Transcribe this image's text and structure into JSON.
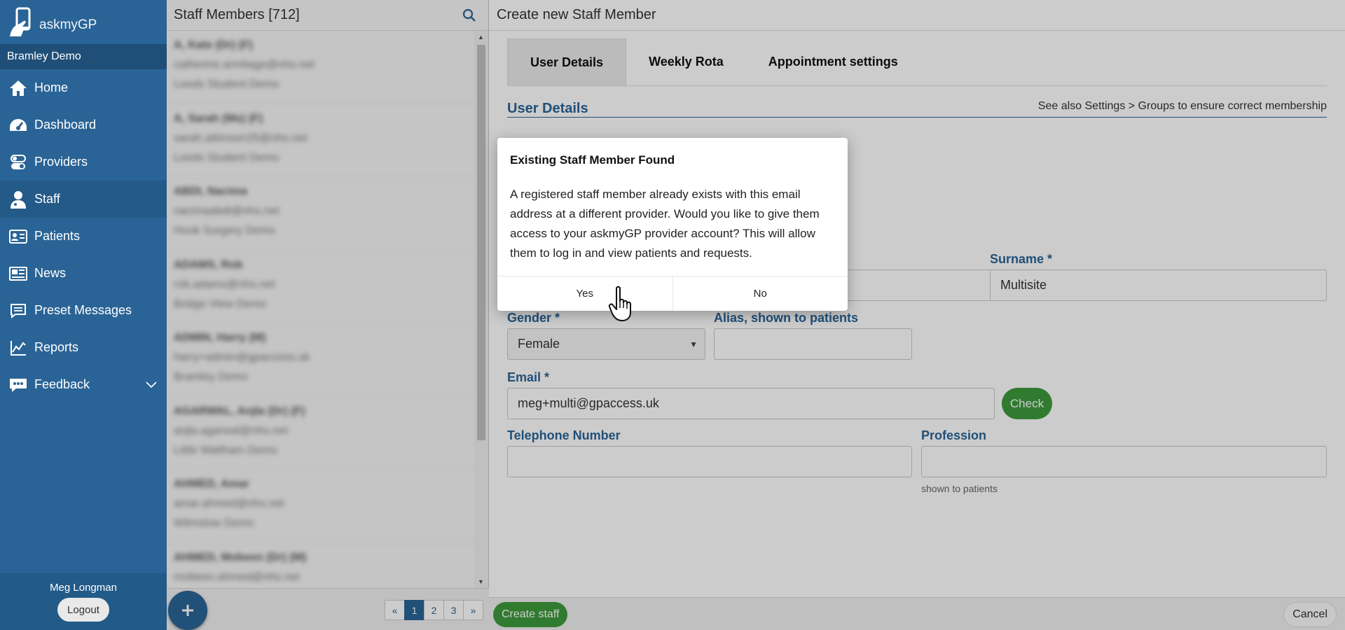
{
  "app": {
    "logo_text": "askmyGP",
    "practice": "Bramley Demo"
  },
  "nav": [
    {
      "label": "Home",
      "icon": "home-icon",
      "active": false
    },
    {
      "label": "Dashboard",
      "icon": "dashboard-icon",
      "active": false
    },
    {
      "label": "Providers",
      "icon": "toggle-icon",
      "active": false
    },
    {
      "label": "Staff",
      "icon": "staff-icon",
      "active": true
    },
    {
      "label": "Patients",
      "icon": "id-card-icon",
      "active": false
    },
    {
      "label": "News",
      "icon": "newspaper-icon",
      "active": false
    },
    {
      "label": "Preset Messages",
      "icon": "chat-icon",
      "active": false
    },
    {
      "label": "Reports",
      "icon": "chart-icon",
      "active": false
    },
    {
      "label": "Feedback",
      "icon": "feedback-icon",
      "active": false
    }
  ],
  "user": {
    "name": "Meg Longman",
    "logout_label": "Logout"
  },
  "list": {
    "title": "Staff Members [712]",
    "items": [
      {
        "name": "A, Kate (Dr) (F)",
        "email": "catherine.armitage@nhs.net",
        "org": "Leeds Student Demo"
      },
      {
        "name": "A, Sarah (Ms) (F)",
        "email": "sarah.atkinson25@nhs.net",
        "org": "Leeds Student Demo"
      },
      {
        "name": "ABDI, Nacima",
        "email": "nacimaabdi@nhs.net",
        "org": "Hook Surgery Demo"
      },
      {
        "name": "ADAMS, Rob",
        "email": "rob.adams@nhs.net",
        "org": "Bridge View Demo"
      },
      {
        "name": "ADMIN, Harry (M)",
        "email": "harry+admin@gpaccess.uk",
        "org": "Bramley Demo"
      },
      {
        "name": "AGARWAL, Anjla (Dr) (F)",
        "email": "anjla.agarwal@nhs.net",
        "org": "Little Waltham Demo"
      },
      {
        "name": "AHMED, Amar",
        "email": "amar.ahmed@nhs.net",
        "org": "Wilmslow Demo"
      },
      {
        "name": "AHMED, Mobeen (Dr) (M)",
        "email": "mobeen.ahmed@nhs.net",
        "org": ""
      }
    ],
    "pages": [
      "«",
      "1",
      "2",
      "3",
      "»"
    ],
    "active_page": "1"
  },
  "main": {
    "title": "Create new Staff Member",
    "tabs": [
      "User Details",
      "Weekly Rota",
      "Appointment settings"
    ],
    "section_title": "User Details",
    "section_note": "See also Settings > Groups to ensure correct membership",
    "fields": {
      "surname_label": "Surname *",
      "surname_value": "Multisite",
      "gender_label": "Gender *",
      "gender_value": "Female",
      "alias_label": "Alias, shown to patients",
      "email_label": "Email *",
      "email_value": "meg+multi@gpaccess.uk",
      "check_label": "Check",
      "phone_label": "Telephone Number",
      "profession_label": "Profession",
      "profession_hint": "shown to patients"
    },
    "create_label": "Create staff",
    "cancel_label": "Cancel"
  },
  "modal": {
    "title": "Existing Staff Member Found",
    "body": "A registered staff member already exists with this email address at a different provider. Would you like to give them access to your askmyGP provider account? This will allow them to log in and view patients and requests.",
    "yes_label": "Yes",
    "no_label": "No"
  },
  "colors": {
    "brand": "#2a6496",
    "success": "#3e9a3c"
  }
}
